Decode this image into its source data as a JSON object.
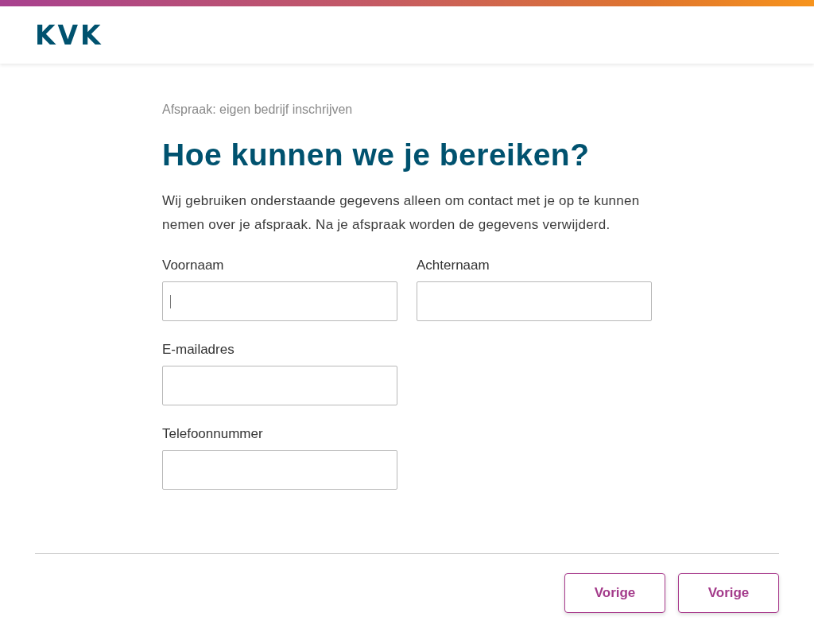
{
  "header": {
    "logo": "KVK"
  },
  "breadcrumb": "Afspraak: eigen bedrijf inschrijven",
  "title": "Hoe kunnen we je bereiken?",
  "intro": "Wij gebruiken onderstaande gegevens alleen om contact met je op te kunnen nemen over je afspraak. Na je afspraak worden de gegevens verwijderd.",
  "form_rows": [
    {
      "fields": [
        {
          "label": "Voornaam",
          "focused": true
        },
        {
          "label": "Achternaam",
          "focused": false
        }
      ]
    },
    {
      "fields": [
        {
          "label": "E-mailadres",
          "focused": false
        }
      ]
    },
    {
      "fields": [
        {
          "label": "Telefoonnummer",
          "focused": false
        }
      ]
    }
  ],
  "buttons": [
    "Vorige",
    "Vorige"
  ]
}
